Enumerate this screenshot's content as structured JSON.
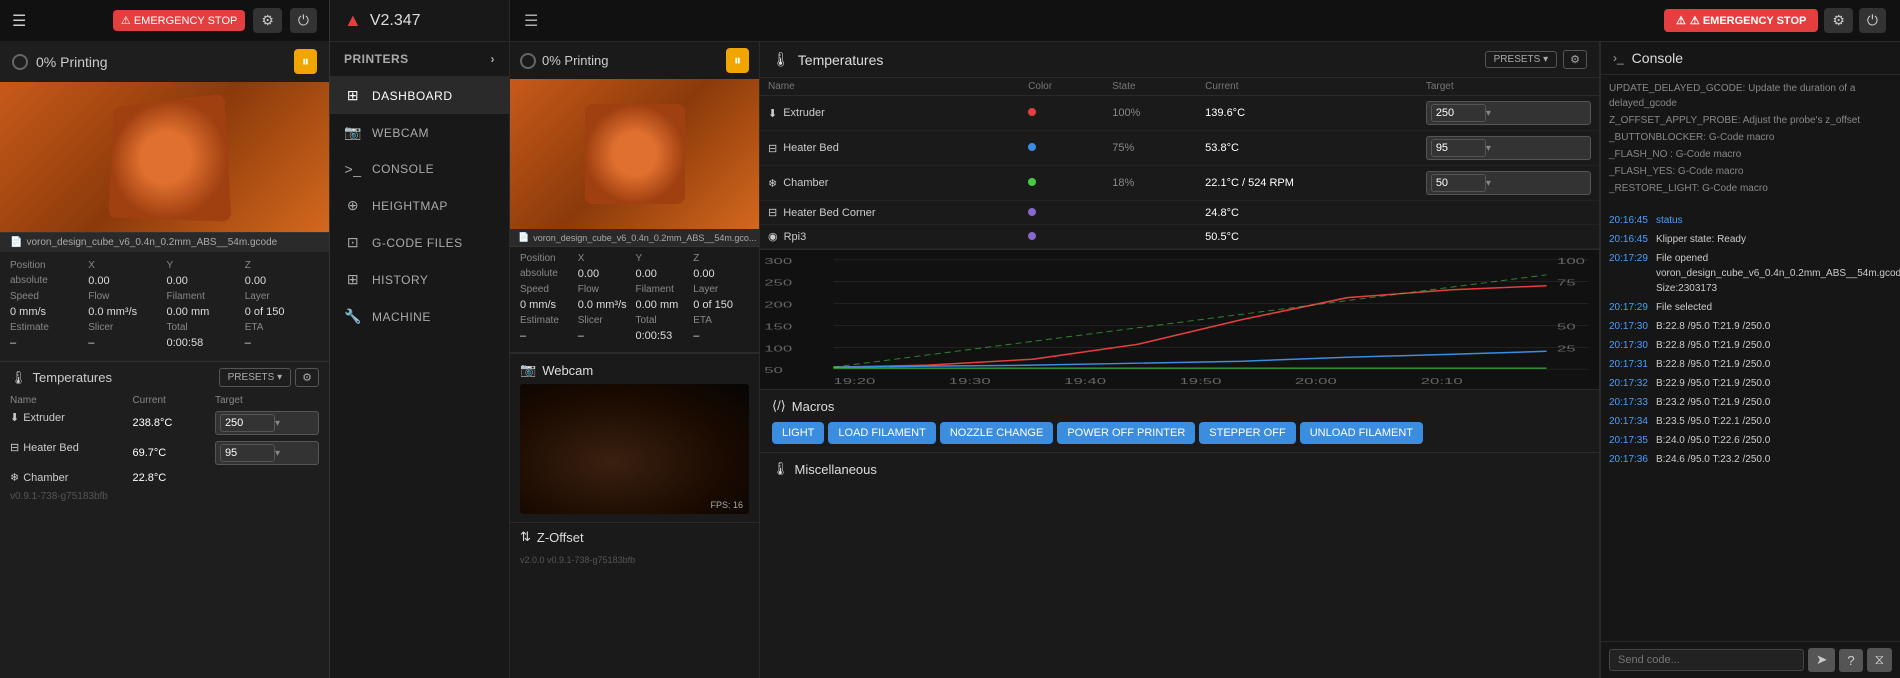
{
  "leftPanel": {
    "menuLabel": "☰",
    "emergencyLabel": "⚠ EMERGENCY STOP",
    "printStatus": "0% Printing",
    "pauseIcon": "⏸",
    "filename": "voron_design_cube_v6_0.4n_0.2mm_ABS__54m.gcode",
    "position": {
      "label": "Position",
      "sublabel": "absolute",
      "x": "0.00",
      "y": "0.00",
      "z": "0.00"
    },
    "speed": {
      "label": "Speed",
      "value": "0 mm/s"
    },
    "flow": {
      "label": "Flow",
      "value": "0.0 mm³/s"
    },
    "filament": {
      "label": "Filament",
      "value": "0.00 mm"
    },
    "layer": {
      "label": "Layer",
      "value": "0 of 150"
    },
    "estimate": {
      "label": "Estimate",
      "value": "–"
    },
    "slicer": {
      "label": "Slicer",
      "value": "–"
    },
    "total": {
      "label": "Total",
      "value": "0:00:58"
    },
    "eta": {
      "label": "ETA",
      "value": "–"
    },
    "tempSectionTitle": "Temperatures",
    "presetsLabel": "PRESETS ▾",
    "tempColumns": [
      "Name",
      "Current",
      "Target"
    ],
    "temperatures": [
      {
        "name": "Extruder",
        "icon": "⬇",
        "current": "238.8°C",
        "target": "250",
        "dot": "#e53e3e"
      },
      {
        "name": "Heater Bed",
        "icon": "⊟",
        "current": "69.7°C",
        "target": "95",
        "dot": "#3b8de0"
      },
      {
        "name": "Chamber",
        "icon": "❄",
        "current": "22.8°C",
        "target": "",
        "dot": ""
      }
    ],
    "version": "v0.9.1-738-g75183bfb"
  },
  "nav": {
    "logo": "▲",
    "title": "V2.347",
    "hamburger": "☰",
    "printersLabel": "PRINTERS",
    "items": [
      {
        "id": "dashboard",
        "label": "DASHBOARD",
        "icon": "⊞",
        "active": true
      },
      {
        "id": "webcam",
        "label": "WEBCAM",
        "icon": "📷"
      },
      {
        "id": "console",
        "label": "CONSOLE",
        "icon": ">_"
      },
      {
        "id": "heightmap",
        "label": "HEIGHTMAP",
        "icon": "⊕"
      },
      {
        "id": "gcodefiles",
        "label": "G-CODE FILES",
        "icon": "⊡"
      },
      {
        "id": "history",
        "label": "HISTORY",
        "icon": "⊞"
      },
      {
        "id": "machine",
        "label": "MACHINE",
        "icon": "🔧"
      }
    ]
  },
  "header": {
    "hamburger": "☰",
    "emergencyLabel": "⚠ EMERGENCY STOP",
    "settingsIcon": "⚙",
    "powerIcon": "⏻"
  },
  "printerStatus": {
    "status": "0% Printing",
    "pauseIcon": "⏸",
    "filename": "voron_design_cube_v6_0.4n_0.2mm_ABS__54m.gco...",
    "position": {
      "label": "Position",
      "sub": "absolute",
      "x": "0.00",
      "y": "0.00",
      "z": "0.00"
    },
    "speed": "0 mm/s",
    "flow": "0.0 mm³/s",
    "filament": "0.00 mm",
    "layer": "0 of 150",
    "estimate": "–",
    "slicer": "–",
    "total": "0:00:53",
    "eta": "–"
  },
  "temperatures": {
    "title": "Temperatures",
    "presetsLabel": "PRESETS ▾",
    "columns": [
      "Name",
      "Color",
      "State",
      "Current",
      "Target"
    ],
    "rows": [
      {
        "name": "Extruder",
        "icon": "⬇",
        "dot": "#e53e3e",
        "state": "100%",
        "current": "139.6°C",
        "target": "250"
      },
      {
        "name": "Heater Bed",
        "icon": "⊟",
        "dot": "#3b8de0",
        "state": "75%",
        "current": "53.8°C",
        "target": "95"
      },
      {
        "name": "Chamber",
        "icon": "❄",
        "dot": "#44cc44",
        "state": "18%",
        "current": "22.1°C / 524 RPM",
        "target": "50"
      },
      {
        "name": "Heater Bed Corner",
        "icon": "⊟",
        "dot": "#8866cc",
        "state": "",
        "current": "24.8°C",
        "target": ""
      },
      {
        "name": "Rpi3",
        "icon": "◉",
        "dot": "#8866cc",
        "state": "",
        "current": "50.5°C",
        "target": ""
      }
    ],
    "chartLabels": [
      "19:20",
      "19:30",
      "19:40",
      "19:50",
      "20:00",
      "20:10"
    ],
    "chartYLabels": [
      "300",
      "250",
      "200",
      "150",
      "100",
      "50"
    ],
    "chartPwmLabels": [
      "100",
      "75",
      "50",
      "25"
    ]
  },
  "macros": {
    "title": "Macros",
    "buttons": [
      "LIGHT",
      "LOAD FILAMENT",
      "NOZZLE CHANGE",
      "POWER OFF PRINTER",
      "STEPPER OFF",
      "UNLOAD FILAMENT"
    ]
  },
  "misc": {
    "title": "Miscellaneous"
  },
  "webcam": {
    "title": "Webcam",
    "fps": "FPS: 16"
  },
  "zoffset": {
    "title": "Z-Offset"
  },
  "console": {
    "title": "Console",
    "icon": ">_",
    "messages": [
      {
        "text": "UPDATE_DELAYED_GCODE: Update the duration of a delayed_gcode"
      },
      {
        "text": "Z_OFFSET_APPLY_PROBE: Adjust the probe's z_offset"
      },
      {
        "text": "_BUTTONBLOCKER: G-Code macro"
      },
      {
        "text": "_FLASH_NO : G-Code macro"
      },
      {
        "text": "_FLASH_YES: G-Code macro"
      },
      {
        "text": "_RESTORE_LIGHT: G-Code macro"
      }
    ],
    "timedMessages": [
      {
        "time": "20:16:45",
        "text": "status",
        "type": "status"
      },
      {
        "time": "20:16:45",
        "text": "Klipper state: Ready"
      },
      {
        "time": "20:17:29",
        "text": "File opened voron_design_cube_v6_0.4n_0.2mm_ABS__54m.gcode Size:2303173"
      },
      {
        "time": "20:17:29",
        "text": "File selected"
      },
      {
        "time": "20:17:30",
        "text": "B:22.8 /95.0 T:21.9 /250.0"
      },
      {
        "time": "20:17:30",
        "text": "B:22.8 /95.0 T:21.9 /250.0"
      },
      {
        "time": "20:17:31",
        "text": "B:22.8 /95.0 T:21.9 /250.0"
      },
      {
        "time": "20:17:32",
        "text": "B:22.9 /95.0 T:21.9 /250.0"
      },
      {
        "time": "20:17:33",
        "text": "B:23.2 /95.0 T:21.9 /250.0"
      },
      {
        "time": "20:17:34",
        "text": "B:23.5 /95.0 T:22.1 /250.0"
      },
      {
        "time": "20:17:35",
        "text": "B:24.0 /95.0 T:22.6 /250.0"
      },
      {
        "time": "20:17:36",
        "text": "B:24.6 /95.0 T:23.2 /250.0"
      }
    ],
    "inputPlaceholder": "Send code...",
    "sendIcon": "➤",
    "helpIcon": "?",
    "filterIcon": "⧖"
  }
}
